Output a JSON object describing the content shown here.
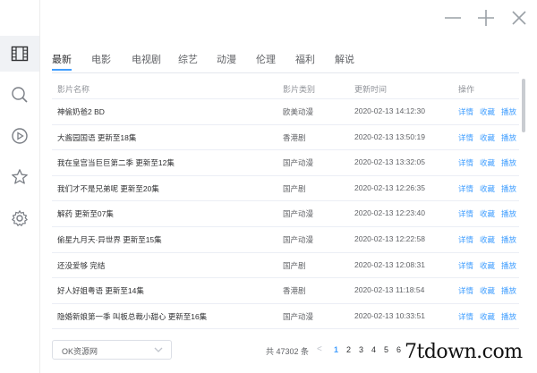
{
  "sidebar": {
    "items": [
      {
        "name": "film-grid-icon"
      },
      {
        "name": "search-icon"
      },
      {
        "name": "play-circle-icon"
      },
      {
        "name": "star-icon"
      },
      {
        "name": "gear-icon"
      }
    ]
  },
  "window": {
    "minimize_icon": "minus-icon",
    "add_icon": "plus-icon",
    "close_icon": "close-icon"
  },
  "tabs": [
    {
      "label": "最新",
      "active": true
    },
    {
      "label": "电影"
    },
    {
      "label": "电视剧"
    },
    {
      "label": "综艺"
    },
    {
      "label": "动漫"
    },
    {
      "label": "伦理"
    },
    {
      "label": "福利"
    },
    {
      "label": "解说"
    }
  ],
  "table": {
    "headers": {
      "name": "影片名称",
      "type": "影片类别",
      "time": "更新时间",
      "action": "操作"
    },
    "actions": {
      "detail": "详情",
      "favorite": "收藏",
      "play": "播放"
    },
    "rows": [
      {
        "name": "神偷奶爸2 BD",
        "type": "欧美动漫",
        "time": "2020-02-13 14:12:30"
      },
      {
        "name": "大酱园国语 更新至18集",
        "type": "香港剧",
        "time": "2020-02-13 13:50:19"
      },
      {
        "name": "我在皇宫当巨巨第二季 更新至12集",
        "type": "国产动漫",
        "time": "2020-02-13 13:32:05"
      },
      {
        "name": "我们才不是兄弟呢 更新至20集",
        "type": "国产剧",
        "time": "2020-02-13 12:26:35"
      },
      {
        "name": "解药 更新至07集",
        "type": "国产动漫",
        "time": "2020-02-13 12:23:40"
      },
      {
        "name": "偷星九月天·异世界 更新至15集",
        "type": "国产动漫",
        "time": "2020-02-13 12:22:58"
      },
      {
        "name": "还没爱够 完结",
        "type": "国产剧",
        "time": "2020-02-13 12:08:31"
      },
      {
        "name": "好人好姐粤语 更新至14集",
        "type": "香港剧",
        "time": "2020-02-13 11:18:54"
      },
      {
        "name": "隐婚新娘第一季 叫板总裁小甜心 更新至16集",
        "type": "国产动漫",
        "time": "2020-02-13 10:33:51"
      }
    ]
  },
  "footer": {
    "source": "OK资源网",
    "total": "共 47302 条",
    "prev": "<",
    "pages": [
      "1",
      "2",
      "3",
      "4",
      "5",
      "6"
    ],
    "current_page": "1"
  },
  "watermark": "7tdown.com",
  "colors": {
    "accent": "#409eff",
    "text": "#303133",
    "muted": "#909399"
  }
}
